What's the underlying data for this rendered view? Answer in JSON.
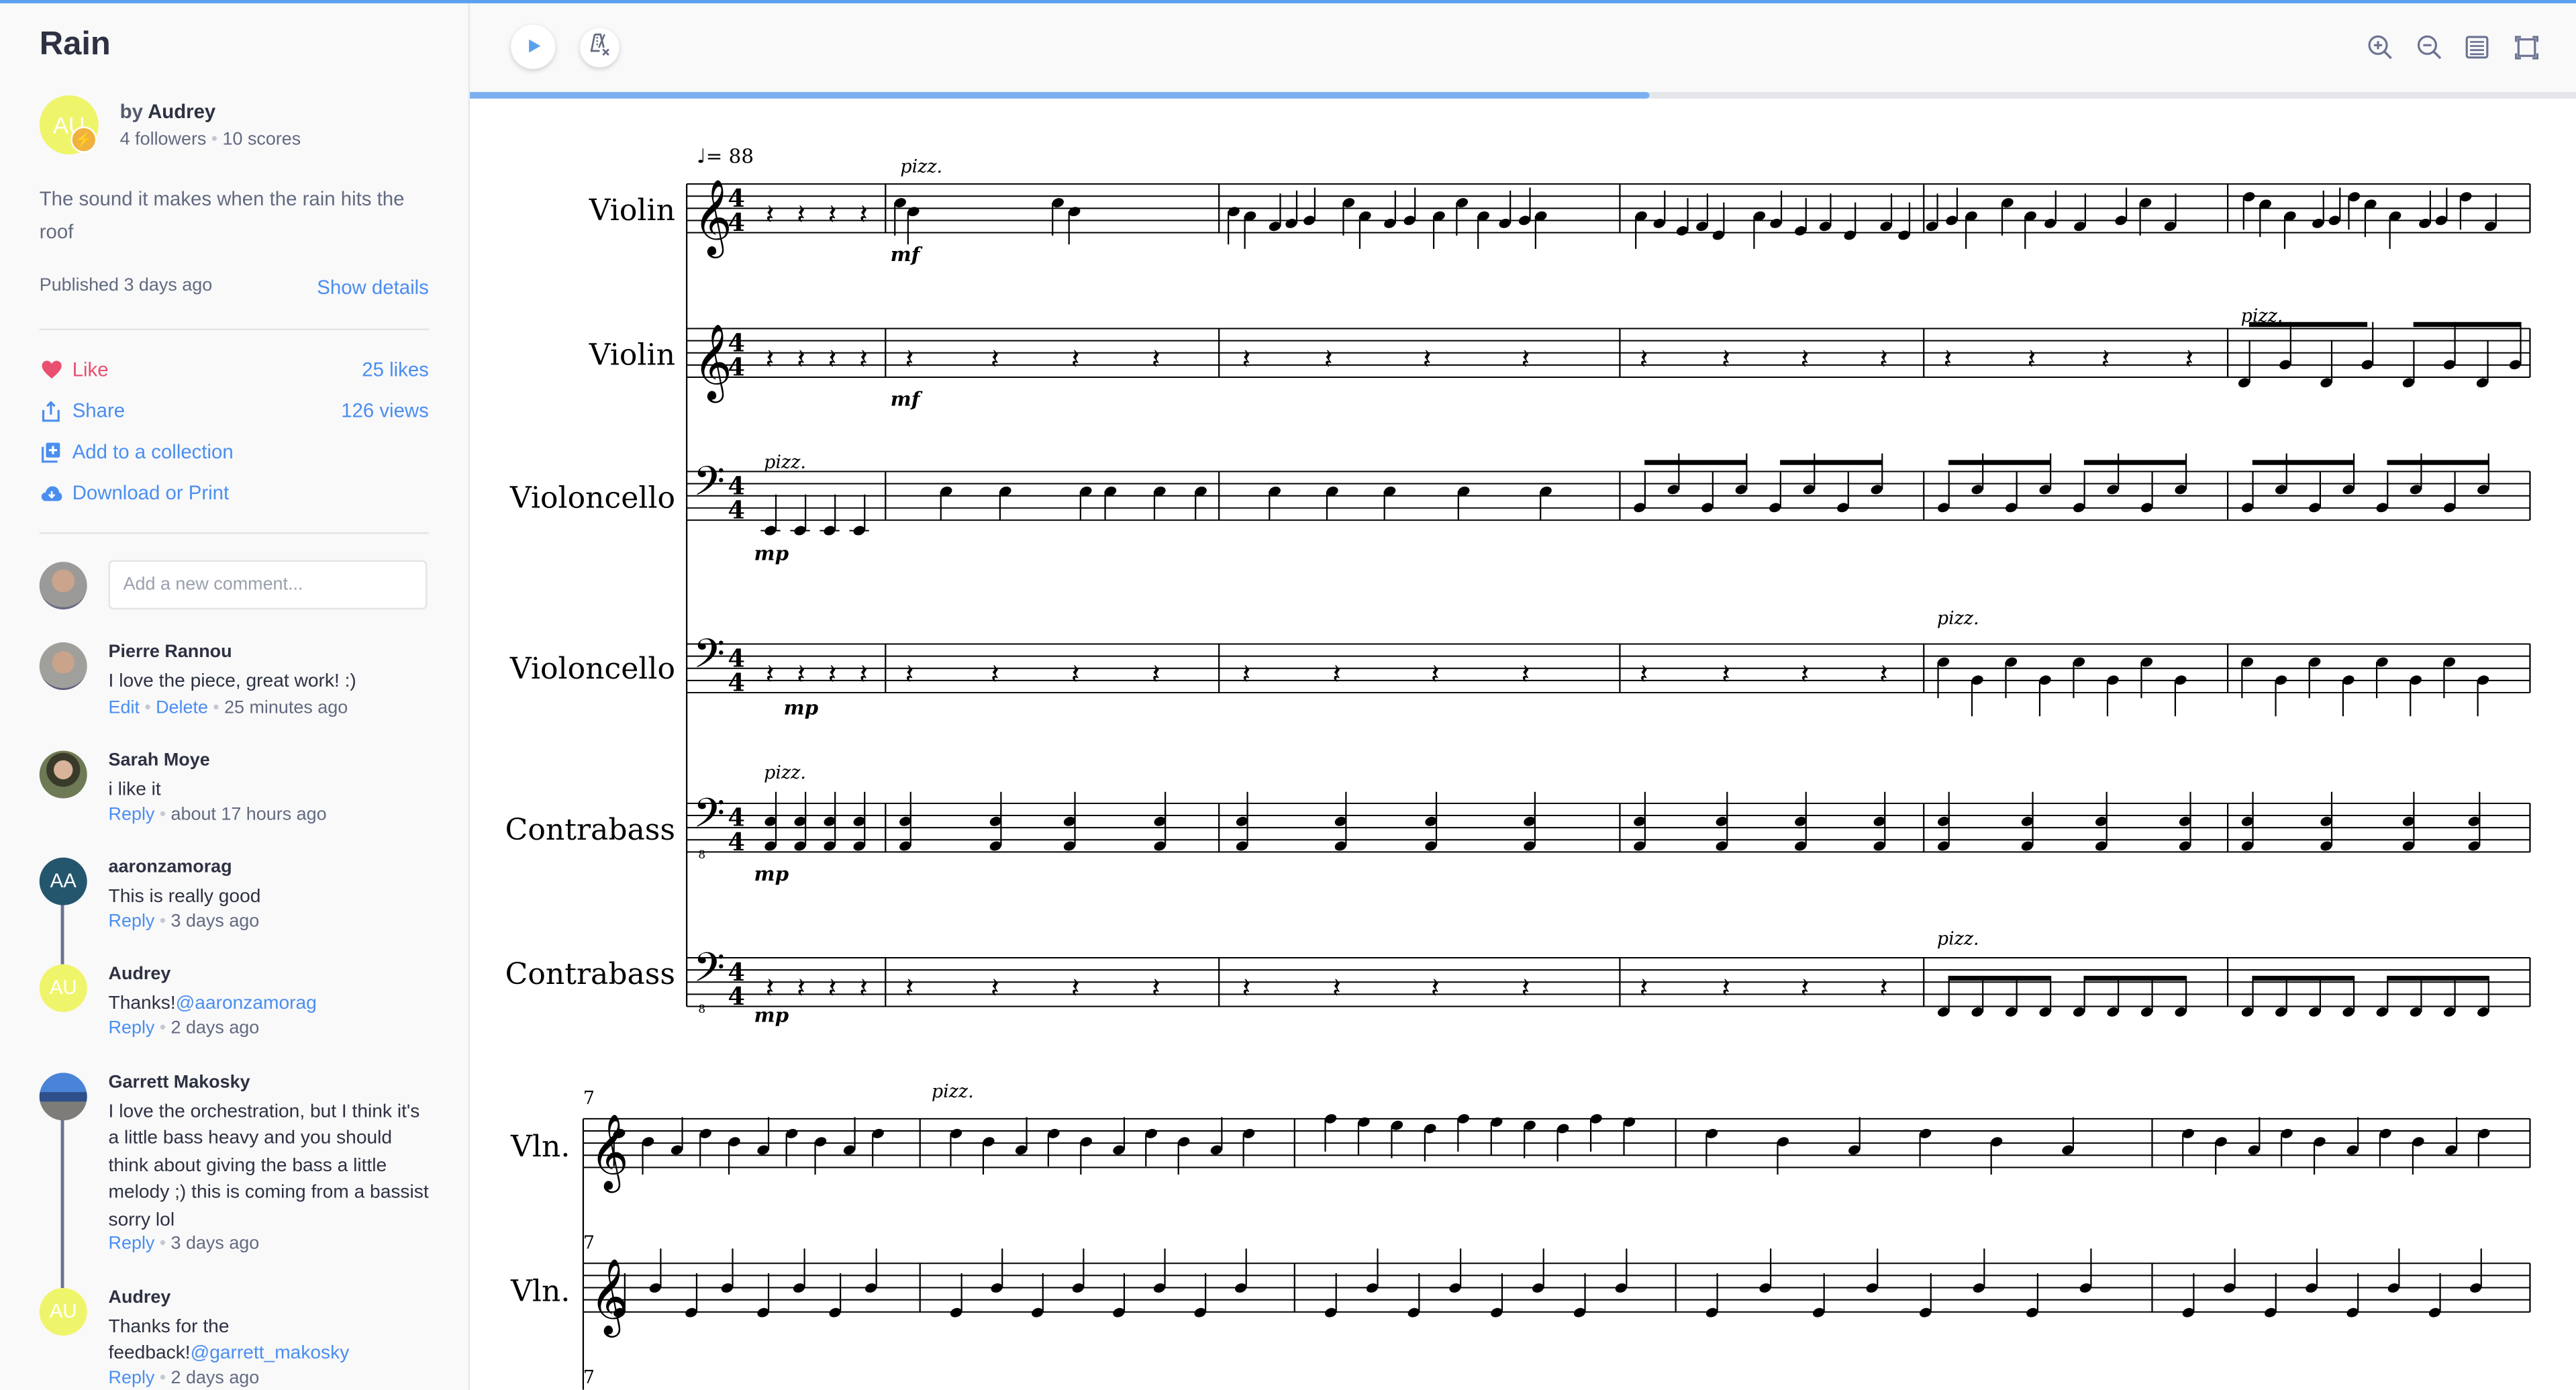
{
  "sidebar": {
    "title": "Rain",
    "author": {
      "initials": "AU",
      "by_prefix": "by",
      "name": "Audrey",
      "followers": "4 followers",
      "scores": "10 scores",
      "avatar_color": "#eff56a"
    },
    "description": "The sound it makes when the rain hits the roof",
    "published": "Published 3 days ago",
    "show_details": "Show details",
    "actions": [
      {
        "icon": "heart-icon",
        "label": "Like",
        "stat": "25 likes"
      },
      {
        "icon": "share-icon",
        "label": "Share",
        "stat": "126 views"
      },
      {
        "icon": "add-collection-icon",
        "label": "Add to a collection",
        "stat": ""
      },
      {
        "icon": "cloud-download-icon",
        "label": "Download or Print",
        "stat": ""
      }
    ],
    "comment_input": {
      "placeholder": "Add a new comment...",
      "value": ""
    },
    "comments": [
      {
        "name": "Pierre Rannou",
        "text": "I love the piece, great work! :)",
        "mention": "",
        "actions": [
          "Edit",
          "Delete"
        ],
        "time": "25 minutes ago",
        "avatar_type": "photo"
      },
      {
        "name": "Sarah Moye",
        "text": "i like it",
        "mention": "",
        "actions": [
          "Reply"
        ],
        "time": "about 17 hours ago",
        "avatar_type": "photo"
      },
      {
        "name": "aaronzamorag",
        "initials": "AA",
        "avatar_color": "#24566e",
        "text": "This is really good",
        "mention": "",
        "actions": [
          "Reply"
        ],
        "time": "3 days ago"
      },
      {
        "name": "Audrey",
        "initials": "AU",
        "avatar_color": "#eff56a",
        "text": "Thanks!",
        "mention": "@aaronzamorag",
        "actions": [
          "Reply"
        ],
        "time": "2 days ago"
      },
      {
        "name": "Garrett Makosky",
        "text": "I love the orchestration, but I think it's a little bass heavy and you should think about giving the bass a little melody ;) this is coming from a bassist sorry lol",
        "mention": "",
        "actions": [
          "Reply"
        ],
        "time": "3 days ago",
        "avatar_type": "photo"
      },
      {
        "name": "Audrey",
        "initials": "AU",
        "avatar_color": "#eff56a",
        "text": "Thanks for the feedback!",
        "mention": "@garrett_makosky",
        "actions": [
          "Reply"
        ],
        "time": "2 days ago"
      }
    ]
  },
  "toolbar": {
    "play": "play-icon",
    "metronome": "metronome-off-icon",
    "right_tools": [
      "zoom-in-icon",
      "zoom-out-icon",
      "page-view-icon",
      "fullscreen-icon"
    ],
    "playback_progress": 0.56
  },
  "score": {
    "tempo_text": "= 88",
    "system1": {
      "staves": [
        {
          "label": "Violin",
          "clef": "treble",
          "annotation": {
            "measure": 2,
            "text": "pizz."
          },
          "dynamic": {
            "measure": 2,
            "text": "mf"
          }
        },
        {
          "label": "Violin",
          "clef": "treble",
          "annotation": {
            "measure": 6,
            "text": "pizz."
          },
          "dynamic": {
            "measure": 2,
            "text": "mf"
          }
        },
        {
          "label": "Violoncello",
          "clef": "bass",
          "annotation": {
            "measure": 1,
            "text": "pizz."
          },
          "dynamic": {
            "measure": 1,
            "text": "mp"
          }
        },
        {
          "label": "Violoncello",
          "clef": "bass",
          "annotation": {
            "measure": 5,
            "text": "pizz."
          },
          "dynamic": {
            "measure": 1,
            "text": "mp"
          }
        },
        {
          "label": "Contrabass",
          "clef": "bass8",
          "annotation": {
            "measure": 1,
            "text": "pizz."
          },
          "dynamic": {
            "measure": 1,
            "text": "mp"
          }
        },
        {
          "label": "Contrabass",
          "clef": "bass8",
          "annotation": {
            "measure": 5,
            "text": "pizz."
          },
          "dynamic": {
            "measure": 1,
            "text": "mp"
          }
        }
      ],
      "time_signature": "4/4"
    },
    "system2": {
      "start_measure": "7",
      "staves": [
        {
          "label": "Vln.",
          "clef": "treble",
          "annotation": {
            "measure": 2,
            "text": "pizz."
          }
        },
        {
          "label": "Vln.",
          "clef": "treble"
        },
        {
          "label": "",
          "clef": "bass"
        }
      ]
    }
  }
}
